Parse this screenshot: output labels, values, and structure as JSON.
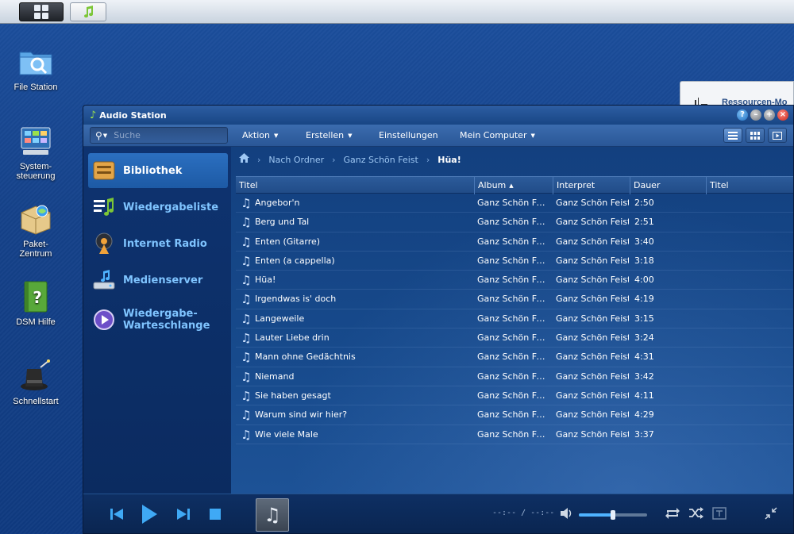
{
  "desktop": {
    "icons": [
      {
        "label": "File Station"
      },
      {
        "label": "System-\nsteuerung"
      },
      {
        "label": "Paket-\nZentrum"
      },
      {
        "label": "DSM Hilfe"
      },
      {
        "label": "Schnellstart"
      }
    ],
    "bg_window_title": "Ressourcen-Mo"
  },
  "window": {
    "title": "Audio Station"
  },
  "toolbar": {
    "search_placeholder": "Suche",
    "aktion": "Aktion",
    "erstellen": "Erstellen",
    "einstellungen": "Einstellungen",
    "mein_computer": "Mein Computer"
  },
  "sidebar": {
    "items": [
      {
        "label": "Bibliothek"
      },
      {
        "label": "Wiedergabeliste"
      },
      {
        "label": "Internet Radio"
      },
      {
        "label": "Medienserver"
      },
      {
        "label": "Wiedergabe-\nWarteschlange"
      }
    ]
  },
  "breadcrumb": {
    "items": [
      "Nach Ordner",
      "Ganz Schön Feist",
      "Hüa!"
    ]
  },
  "table": {
    "headers": {
      "titel": "Titel",
      "album": "Album",
      "interpret": "Interpret",
      "dauer": "Dauer",
      "titel2": "Titel"
    },
    "rows": [
      {
        "title": "Angebor'n",
        "album": "Ganz Schön Fei...",
        "artist": "Ganz Schön Feist",
        "duration": "2:50"
      },
      {
        "title": "Berg und Tal",
        "album": "Ganz Schön Fei...",
        "artist": "Ganz Schön Feist",
        "duration": "2:51"
      },
      {
        "title": "Enten (Gitarre)",
        "album": "Ganz Schön Fei...",
        "artist": "Ganz Schön Feist",
        "duration": "3:40"
      },
      {
        "title": "Enten (a cappella)",
        "album": "Ganz Schön Fei...",
        "artist": "Ganz Schön Feist",
        "duration": "3:18"
      },
      {
        "title": "Hüa!",
        "album": "Ganz Schön Fei...",
        "artist": "Ganz Schön Feist",
        "duration": "4:00"
      },
      {
        "title": "Irgendwas is' doch",
        "album": "Ganz Schön Fei...",
        "artist": "Ganz Schön Feist",
        "duration": "4:19"
      },
      {
        "title": "Langeweile",
        "album": "Ganz Schön Fei...",
        "artist": "Ganz Schön Feist",
        "duration": "3:15"
      },
      {
        "title": "Lauter Liebe drin",
        "album": "Ganz Schön Fei...",
        "artist": "Ganz Schön Feist",
        "duration": "3:24"
      },
      {
        "title": "Mann ohne Gedächtnis",
        "album": "Ganz Schön Fei...",
        "artist": "Ganz Schön Feist",
        "duration": "4:31"
      },
      {
        "title": "Niemand",
        "album": "Ganz Schön Fei...",
        "artist": "Ganz Schön Feist",
        "duration": "3:42"
      },
      {
        "title": "Sie haben gesagt",
        "album": "Ganz Schön Fei...",
        "artist": "Ganz Schön Feist",
        "duration": "4:11"
      },
      {
        "title": "Warum sind wir hier?",
        "album": "Ganz Schön Fei...",
        "artist": "Ganz Schön Feist",
        "duration": "4:29"
      },
      {
        "title": "Wie viele Male",
        "album": "Ganz Schön Fei...",
        "artist": "Ganz Schön Feist",
        "duration": "3:37"
      }
    ]
  },
  "player": {
    "time": "--:-- / --:--",
    "volume_percent": 50
  },
  "colors": {
    "accent": "#4fb3ff",
    "sidebar_text": "#7fc4ff",
    "close": "#c8261b"
  }
}
